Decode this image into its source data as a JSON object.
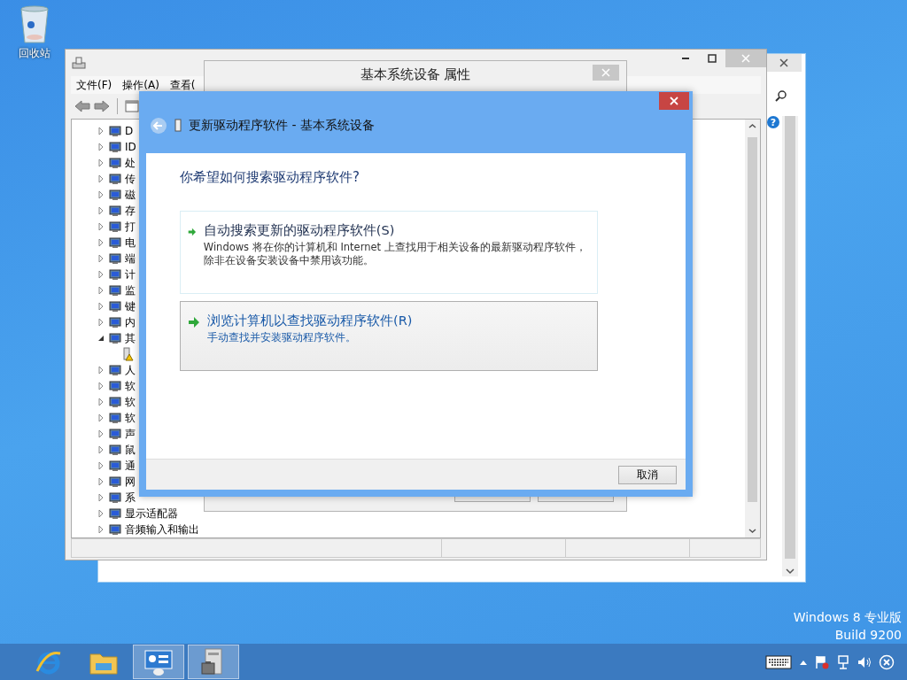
{
  "desktop_icons": [
    {
      "label": "回收站"
    }
  ],
  "back_window": {
    "help_glyph": "?"
  },
  "device_manager": {
    "menu": [
      "文件(F)",
      "操作(A)",
      "查看("
    ],
    "tree": [
      {
        "label": "D",
        "expanded": false
      },
      {
        "label": "ID",
        "expanded": false
      },
      {
        "label": "处",
        "expanded": false
      },
      {
        "label": "传",
        "expanded": false
      },
      {
        "label": "磁",
        "expanded": false
      },
      {
        "label": "存",
        "expanded": false
      },
      {
        "label": "打",
        "expanded": false
      },
      {
        "label": "电",
        "expanded": false
      },
      {
        "label": "端",
        "expanded": false
      },
      {
        "label": "计",
        "expanded": false
      },
      {
        "label": "监",
        "expanded": false
      },
      {
        "label": "键",
        "expanded": false
      },
      {
        "label": "内",
        "expanded": false
      },
      {
        "label": "其",
        "expanded": true,
        "children": [
          {
            "warning": true
          }
        ]
      },
      {
        "label": "人",
        "expanded": false
      },
      {
        "label": "软",
        "expanded": false
      },
      {
        "label": "软",
        "expanded": false
      },
      {
        "label": "软",
        "expanded": false
      },
      {
        "label": "声",
        "expanded": false
      },
      {
        "label": "鼠",
        "expanded": false
      },
      {
        "label": "通",
        "expanded": false
      },
      {
        "label": "网",
        "expanded": false
      },
      {
        "label": "系",
        "expanded": false
      },
      {
        "label": "显示适配器",
        "expanded": false
      },
      {
        "label": "音频输入和输出",
        "expanded": false
      }
    ]
  },
  "properties_dialog": {
    "title": "基本系统设备 属性"
  },
  "wizard": {
    "title": "更新驱动程序软件 - 基本系统设备",
    "question": "你希望如何搜索驱动程序软件?",
    "options": [
      {
        "title": "自动搜索更新的驱动程序软件(S)",
        "description": "Windows 将在你的计算机和 Internet 上查找用于相关设备的最新驱动程序软件，除非在设备安装设备中禁用该功能。",
        "selected": false
      },
      {
        "title": "浏览计算机以查找驱动程序软件(R)",
        "description": "手动查找并安装驱动程序软件。",
        "selected": true
      }
    ],
    "cancel": "取消"
  },
  "watermark": [
    "Windows 8 专业版",
    "Build 9200"
  ],
  "taskbar": {
    "apps": [
      {
        "kind": "browser",
        "active": false
      },
      {
        "kind": "explorer",
        "active": false
      },
      {
        "kind": "control-panel",
        "active": true
      },
      {
        "kind": "device-manager",
        "active": true
      }
    ]
  }
}
